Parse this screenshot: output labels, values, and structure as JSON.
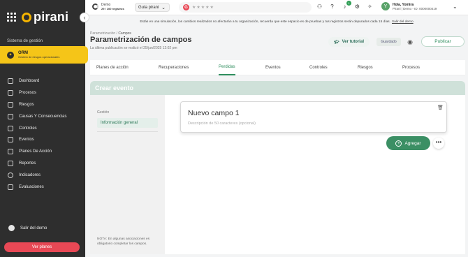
{
  "brand": {
    "logo_text": "pirani"
  },
  "sidebar": {
    "system_label": "Sistema de gestión",
    "module": {
      "title": "ORM",
      "subtitle": "Gestión de riesgos operacionales"
    },
    "items": [
      {
        "label": "Dashboard",
        "icon": "monitor-icon"
      },
      {
        "label": "Procesos",
        "icon": "process-icon"
      },
      {
        "label": "Riesgos",
        "icon": "risk-icon"
      },
      {
        "label": "Causas Y Consecuencias",
        "icon": "causes-icon"
      },
      {
        "label": "Controles",
        "icon": "controls-icon"
      },
      {
        "label": "Eventos",
        "icon": "warning-icon"
      },
      {
        "label": "Planes De Acción",
        "icon": "action-plan-icon"
      },
      {
        "label": "Reportes",
        "icon": "reports-icon"
      },
      {
        "label": "Indicadores",
        "icon": "indicators-icon"
      },
      {
        "label": "Evaluaciones",
        "icon": "evaluations-icon"
      }
    ],
    "exit_label": "Salir del demo",
    "plans_label": "Ver planes"
  },
  "topbar": {
    "demo_title": "Demo",
    "demo_records": "29 / 100 registros",
    "guide_label": "Guía pirani",
    "rating_stars": "★★★★★",
    "notification_count": "1",
    "user_greeting": "Hola, Yomira",
    "user_org": "Pirani | Demo - ID: 0000000419",
    "user_initial": "Y"
  },
  "banner": {
    "text": "Estás en una simulación, los cambios realizados no afectarán a tu organización, recuerda que este espacio es de pruebas y tus registros serán depurados cada 15 días.",
    "link": "Salir del demo"
  },
  "header": {
    "breadcrumb_parent": "Parametrización",
    "breadcrumb_sep": "/",
    "breadcrumb_current": "Campos",
    "title": "Parametrización de campos",
    "published": "La última publicación se realizó el 25/jun/2025 12:02 pm",
    "tutorial_label": "Ver tutorial",
    "saved_label": "Guardado",
    "publish_label": "Publicar"
  },
  "tabs": [
    "Planes de acción",
    "Recuperaciones",
    "Perdidas",
    "Eventos",
    "Controles",
    "Riesgos",
    "Procesos"
  ],
  "active_tab": "Perdidas",
  "event": {
    "header": "Crear evento",
    "section_label": "Gestión",
    "section_item": "Información general",
    "note": "NOTA: En algunas asociaciones es obligatorio completar los campos.",
    "field_title": "Nuevo campo 1",
    "field_desc": "Descripción de 50 caracteres (opcional)",
    "add_label": "Agregar",
    "more_label": "•••"
  },
  "colors": {
    "sidebar": "#2e2e2e",
    "accent_yellow": "#f5c518",
    "primary_green": "#3b8f64",
    "danger_red": "#e84855"
  }
}
